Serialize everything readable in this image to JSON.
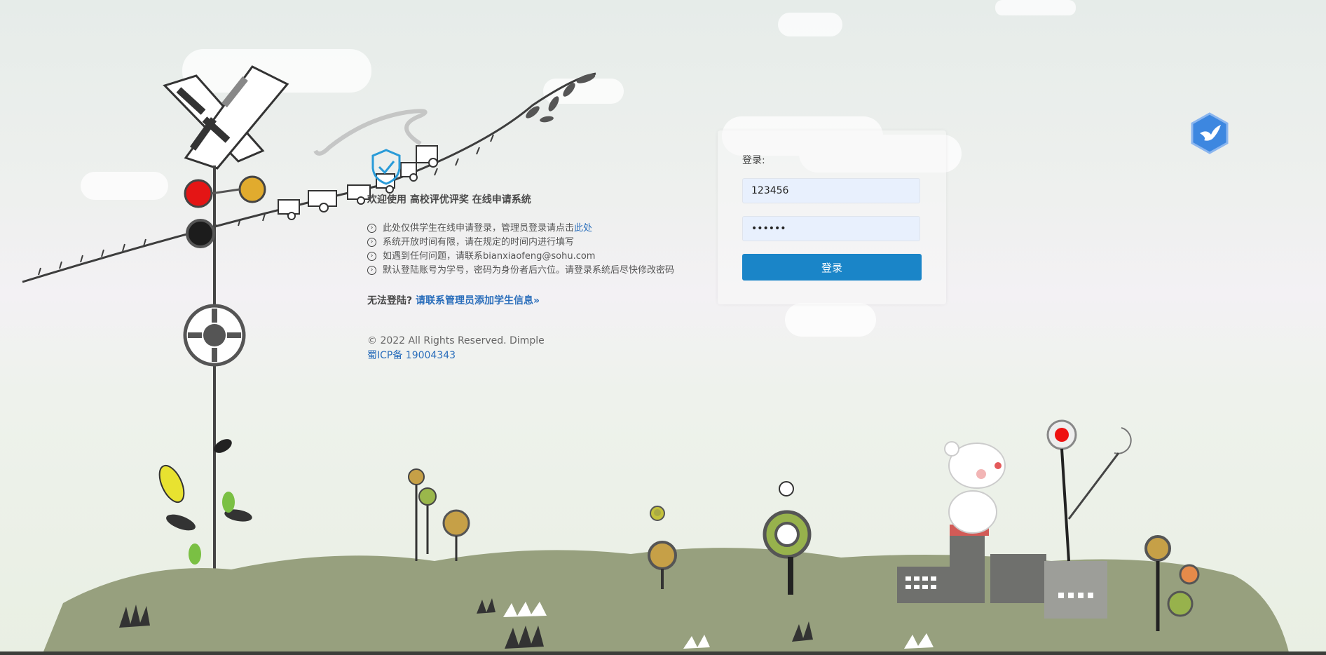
{
  "welcome": "欢迎使用 高校评优评奖 在线申请系统",
  "notes": {
    "n1_prefix": "此处仅供学生在线申请登录，管理员登录请点击",
    "n1_link": "此处",
    "n2": "系统开放时间有限，请在规定的时间内进行填写",
    "n3": "如遇到任何问题，请联系bianxiaofeng@sohu.com",
    "n4": "默认登陆账号为学号，密码为身份者后六位。请登录系统后尽快修改密码"
  },
  "cannot_login": {
    "label": "无法登陆?",
    "link": "请联系管理员添加学生信息»"
  },
  "footer": {
    "copyright": "© 2022 All Rights Reserved. Dimple",
    "icp": "蜀ICP备 19004343"
  },
  "login": {
    "title": "登录:",
    "username": "123456",
    "password": "123456",
    "button": "登录"
  },
  "icons": {
    "bullet": "circle-arrow-icon",
    "logo": "bird-hexagon-icon",
    "shield": "shield-check-icon"
  },
  "colors": {
    "accent": "#1a85c8",
    "link": "#2a6ebb",
    "input_bg": "#e8f0fd"
  }
}
